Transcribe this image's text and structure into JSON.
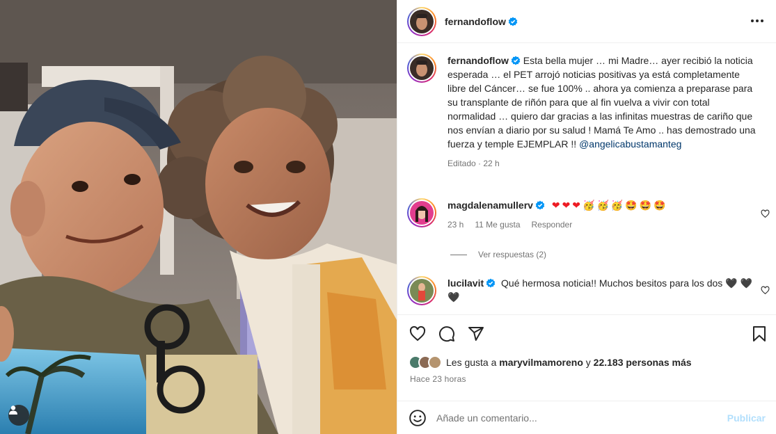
{
  "post": {
    "author": "fernandoflow",
    "caption": "Esta bella mujer … mi Madre… ayer recibió la noticia esperada … el PET arrojó noticias positivas ya está completamente libre del Cáncer… se fue 100% .. ahora ya comienza a preparase para su transplante de riñón para que al fin vuelva a vivir con total normalidad … quiero dar gracias a las infinitas muestras de cariño que nos envían a diario por su salud ! Mamá Te Amo .. has demostrado una fuerza y temple EJEMPLAR !!",
    "mention": "@angelicabustamanteg",
    "edited_label": "Editado",
    "edited_time": "22 h"
  },
  "comments": [
    {
      "user": "magdalenamullerv",
      "text_emojis": [
        "❤",
        "❤",
        "❤",
        "🥳",
        "🥳",
        "🥳",
        "🤩",
        "🤩",
        "🤩"
      ],
      "time": "23 h",
      "likes": "11 Me gusta",
      "reply_label": "Responder"
    },
    {
      "user": "lucilavit",
      "text": "Qué hermosa noticia!! Muchos besitos para los dos 🖤 🖤🖤"
    }
  ],
  "view_replies": "Ver respuestas (2)",
  "likes": {
    "prefix": "Les gusta a",
    "user": "maryvilmamoreno",
    "connector": "y",
    "others": "22.183 personas más"
  },
  "time_ago": "Hace 23 horas",
  "add_comment": {
    "placeholder": "Añade un comentario...",
    "post_label": "Publicar"
  },
  "colors": {
    "verified": "#0095f6",
    "link": "#00376b",
    "muted": "#737373",
    "post_button_disabled": "#b2dffc"
  }
}
